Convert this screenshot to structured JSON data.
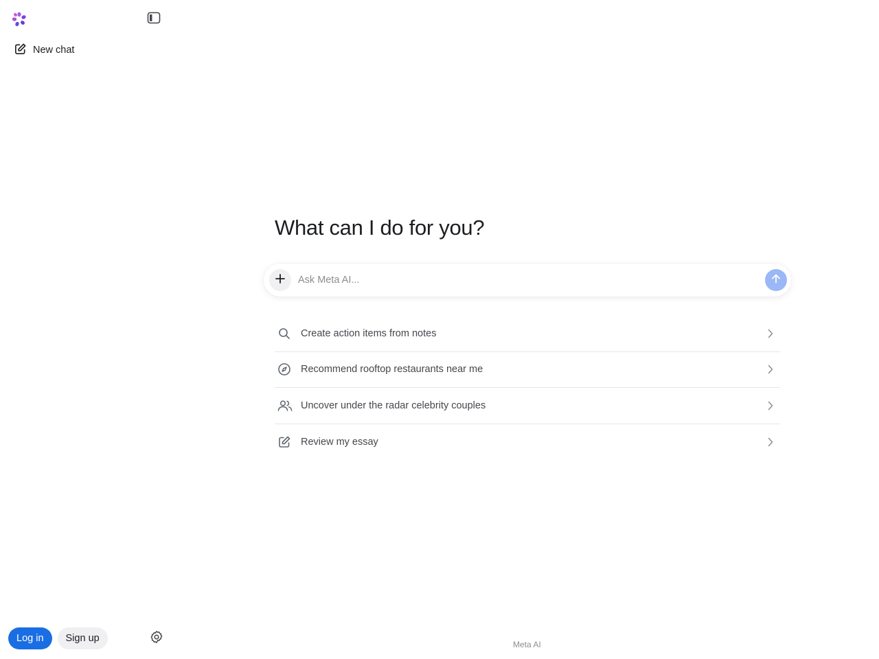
{
  "sidebar": {
    "logo_icon": "meta-ai-flower-icon",
    "collapse_icon": "sidebar-toggle-icon",
    "new_chat_label": "New chat",
    "new_chat_icon": "pencil-square-icon",
    "login_label": "Log in",
    "signup_label": "Sign up",
    "settings_icon": "gear-icon"
  },
  "main": {
    "heading": "What can I do for you?",
    "composer": {
      "placeholder": "Ask Meta AI...",
      "value": "",
      "plus_icon": "plus-icon",
      "send_icon": "arrow-up-icon"
    },
    "suggestions": [
      {
        "label": "Create action items from notes",
        "icon": "search-icon"
      },
      {
        "label": "Recommend rooftop restaurants near me",
        "icon": "compass-icon"
      },
      {
        "label": "Uncover under the radar celebrity couples",
        "icon": "people-icon"
      },
      {
        "label": "Review my essay",
        "icon": "pencil-square-icon"
      }
    ]
  },
  "footer": {
    "label": "Meta AI"
  },
  "colors": {
    "accent": "#1a6ee4",
    "send_disabled": "#9ab8f5",
    "divider": "#e4e6eb",
    "logo_purple": "#8b4fe0"
  }
}
